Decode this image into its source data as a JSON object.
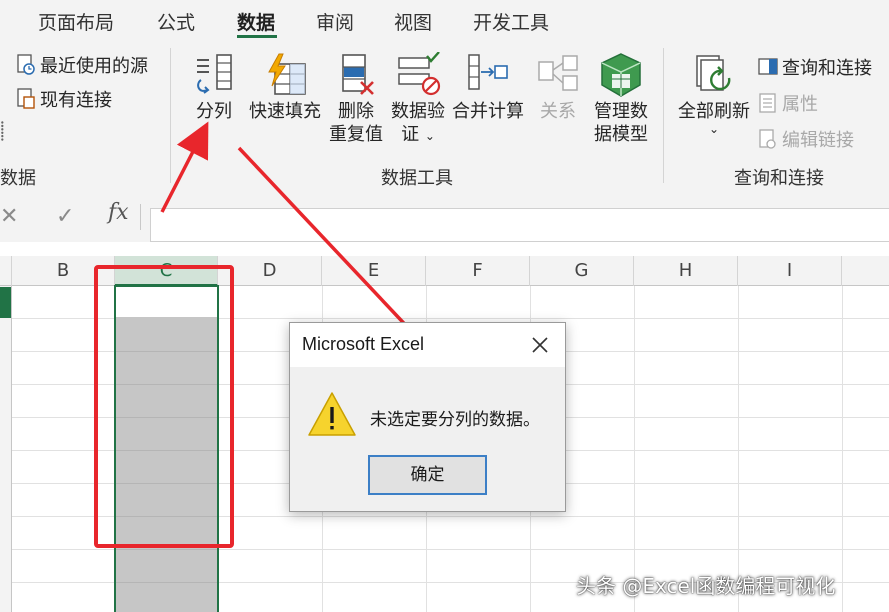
{
  "ribbon_tabs": [
    "页面布局",
    "公式",
    "数据",
    "审阅",
    "视图",
    "开发工具"
  ],
  "active_tab": "数据",
  "get_data_group": {
    "recent_sources": "最近使用的源",
    "existing_connections": "现有连接",
    "label": "数据"
  },
  "data_tools_group": {
    "label": "数据工具",
    "text_to_columns": "分列",
    "flash_fill": "快速填充",
    "remove_duplicates_1": "删除",
    "remove_duplicates_2": "重复值",
    "data_validation_1": "数据验",
    "data_validation_2": "证",
    "consolidate": "合并计算",
    "relationships": "关系",
    "manage_data_model_1": "管理数",
    "manage_data_model_2": "据模型"
  },
  "queries_group": {
    "label": "查询和连接",
    "refresh_all": "全部刷新",
    "queries_connections": "查询和连接",
    "properties": "属性",
    "edit_links": "编辑链接"
  },
  "formula_bar": {
    "cancel": "✕",
    "enter": "✓",
    "fx": "fx",
    "value": ""
  },
  "columns": [
    "B",
    "C",
    "D",
    "E",
    "F",
    "G",
    "H",
    "I"
  ],
  "selected_column": "C",
  "dialog": {
    "title": "Microsoft Excel",
    "message": "未选定要分列的数据。",
    "ok_label": "确定",
    "icon": "warning-icon"
  },
  "watermark": "头条 @Excel函数编程可视化",
  "colors": {
    "excel_green": "#217346",
    "annotation_red": "#e8262c",
    "selection_fill": "#c6c6c6",
    "ribbon_bg": "#f3f3f3"
  }
}
